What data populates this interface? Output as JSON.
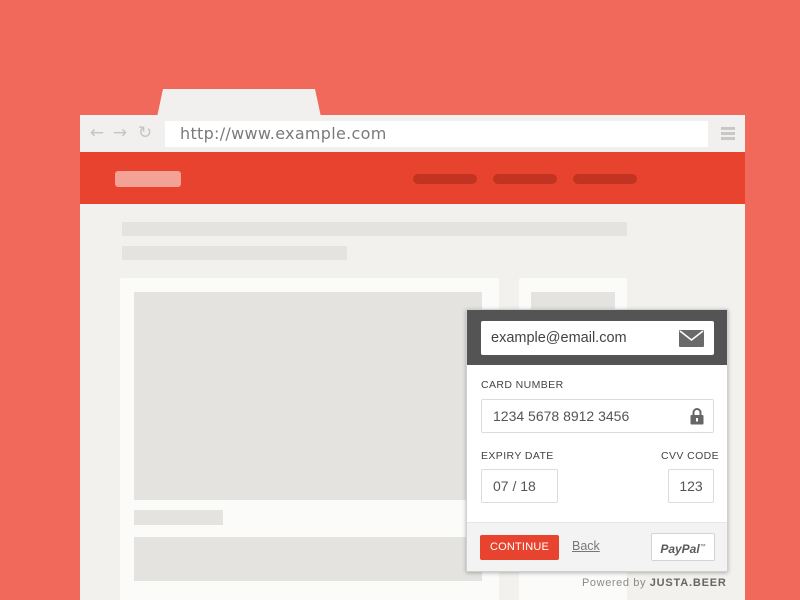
{
  "browser": {
    "url": "http://www.example.com",
    "icons": {
      "back": "arrow-left-icon",
      "forward": "arrow-right-icon",
      "reload": "reload-icon",
      "menu": "hamburger-menu-icon"
    }
  },
  "payment": {
    "email_value": "example@email.com",
    "card_number_label": "CARD NUMBER",
    "card_number_value": "1234 5678 8912 3456",
    "expiry_label": "EXPIRY DATE",
    "expiry_value": "07 / 18",
    "cvv_label": "CVV CODE",
    "cvv_value": "123",
    "continue_label": "CONTINUE",
    "back_label": "Back",
    "paypal_label": "PayPal",
    "paypal_tm": "™"
  },
  "footer": {
    "powered_prefix": "Powered by",
    "powered_brand": "JUSTA.BEER"
  },
  "colors": {
    "background": "#f0695a",
    "brand_red": "#e8432e",
    "widget_header": "#545454"
  }
}
